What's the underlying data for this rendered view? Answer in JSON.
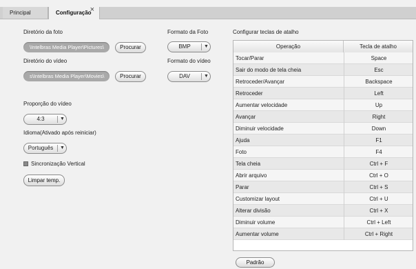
{
  "tabs": [
    {
      "label": "Principal"
    },
    {
      "label": "Configuração"
    }
  ],
  "tab_close_glyph": "×",
  "photo": {
    "dir_label": "Diretório da foto",
    "dir_value": "\\Intelbras Media Player\\Pictures\\",
    "browse_label": "Procurar",
    "format_label": "Formato da Foto",
    "format_value": "BMP"
  },
  "video": {
    "dir_label": "Diretório do vídeo",
    "dir_value": "s\\Intelbras Media Player\\Movies\\",
    "browse_label": "Procurar",
    "format_label": "Formato do vídeo",
    "format_value": "DAV"
  },
  "aspect": {
    "label": "Proporção do vídeo",
    "value": "4:3"
  },
  "language": {
    "label": "Idioma(Ativado após reiniciar)",
    "value": "Português"
  },
  "vsync": {
    "label": "Sincronização Vertical",
    "checked": true
  },
  "clear_temp_label": "Limpar temp.",
  "shortcuts": {
    "title": "Configurar teclas de atalho",
    "col_operation": "Operação",
    "col_key": "Tecla de atalho",
    "rows": [
      {
        "op": "Tocar/Parar",
        "key": "Space"
      },
      {
        "op": "Sair do modo de tela cheia",
        "key": "Esc"
      },
      {
        "op": "Retroceder/Avançar",
        "key": "Backspace"
      },
      {
        "op": "Retroceder",
        "key": "Left"
      },
      {
        "op": "Aumentar velocidade",
        "key": "Up"
      },
      {
        "op": "Avançar",
        "key": "Right"
      },
      {
        "op": "Diminuir velocidade",
        "key": "Down"
      },
      {
        "op": "Ajuda",
        "key": "F1"
      },
      {
        "op": "Foto",
        "key": "F4"
      },
      {
        "op": "Tela cheia",
        "key": "Ctrl + F"
      },
      {
        "op": "Abrir arquivo",
        "key": "Ctrl + O"
      },
      {
        "op": "Parar",
        "key": "Ctrl + S"
      },
      {
        "op": "Customizar layout",
        "key": "Ctrl + U"
      },
      {
        "op": "Alterar divisão",
        "key": "Ctrl + X"
      },
      {
        "op": "Diminuir volume",
        "key": "Ctrl + Left"
      },
      {
        "op": "Aumentar volume",
        "key": "Ctrl + Right"
      }
    ],
    "default_label": "Padrão"
  },
  "icons": {
    "dropdown_arrow": "▼",
    "checkbox": "checkbox-icon"
  },
  "colors": {
    "path_field_bg": "#a9a9a9",
    "tab_strip_bg": "#d0d0d0"
  }
}
